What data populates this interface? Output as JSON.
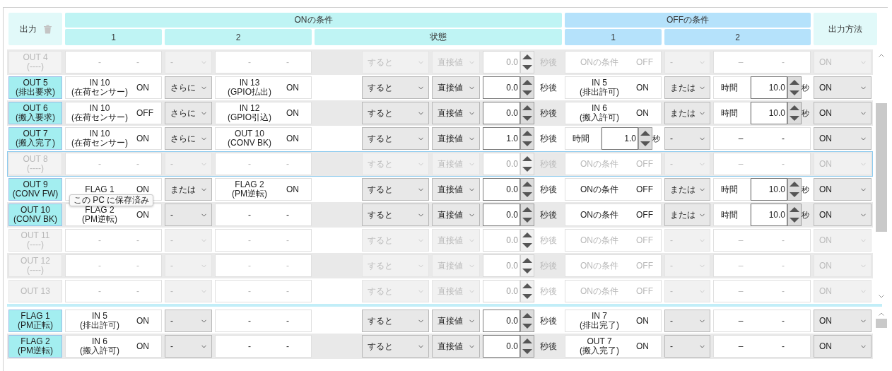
{
  "header": {
    "output": "出力",
    "on_group": "ONの条件",
    "on_cols": [
      "1",
      "2",
      "状態"
    ],
    "off_group": "OFFの条件",
    "off_cols": [
      "1",
      "2"
    ],
    "method": "出力方法"
  },
  "outputs": [
    {
      "label": "OUT 4",
      "sub": "(----)",
      "enabled": false,
      "selected": false,
      "on1": {
        "name": "-",
        "state": "-"
      },
      "on_join": "-",
      "on2": {
        "name": "-",
        "state": "-"
      },
      "trigger": "すると",
      "source": "直接値",
      "delay": "0.0",
      "delay_unit": "秒後",
      "off1": {
        "kind": "cond",
        "name": "ONの条件",
        "state": "OFF"
      },
      "off_join": "-",
      "off2": {
        "kind": "none",
        "mark": "–",
        "state": "-"
      },
      "method": "ON"
    },
    {
      "label": "OUT 5",
      "sub": "(排出要求)",
      "enabled": true,
      "selected": false,
      "on1": {
        "name": "IN 10",
        "sub": "(在荷センサー)",
        "state": "ON"
      },
      "on_join": "さらに",
      "on2": {
        "name": "IN 13",
        "sub": "(GPIO払出)",
        "state": "ON"
      },
      "trigger": "すると",
      "source": "直接値",
      "delay": "0.0",
      "delay_unit": "秒後",
      "off1": {
        "kind": "cond",
        "name": "IN 5",
        "sub": "(排出許可)",
        "state": "ON"
      },
      "off_join": "または",
      "off2": {
        "kind": "time",
        "label": "時間",
        "value": "10.0",
        "unit": "秒"
      },
      "method": "ON"
    },
    {
      "label": "OUT 6",
      "sub": "(搬入要求)",
      "enabled": true,
      "selected": false,
      "on1": {
        "name": "IN 10",
        "sub": "(在荷センサー)",
        "state": "OFF"
      },
      "on_join": "さらに",
      "on2": {
        "name": "IN 12",
        "sub": "(GPIO引込)",
        "state": "ON"
      },
      "trigger": "すると",
      "source": "直接値",
      "delay": "0.0",
      "delay_unit": "秒後",
      "off1": {
        "kind": "cond",
        "name": "IN 6",
        "sub": "(搬入許可)",
        "state": "ON"
      },
      "off_join": "または",
      "off2": {
        "kind": "time",
        "label": "時間",
        "value": "10.0",
        "unit": "秒"
      },
      "method": "ON"
    },
    {
      "label": "OUT 7",
      "sub": "(搬入完了)",
      "enabled": true,
      "selected": false,
      "on1": {
        "name": "IN 10",
        "sub": "(在荷センサー)",
        "state": "ON"
      },
      "on_join": "さらに",
      "on2": {
        "name": "OUT 10",
        "sub": "(CONV BK)",
        "state": "ON"
      },
      "trigger": "すると",
      "source": "直接値",
      "delay": "1.0",
      "delay_unit": "秒後",
      "off1": {
        "kind": "time",
        "label": "時間",
        "value": "1.0",
        "unit": "秒"
      },
      "off_join": "-",
      "off2": {
        "kind": "none",
        "mark": "–",
        "state": "-"
      },
      "method": "ON"
    },
    {
      "label": "OUT 8",
      "sub": "(----)",
      "enabled": false,
      "selected": true,
      "on1": {
        "name": "-",
        "state": "-"
      },
      "on_join": "-",
      "on2": {
        "name": "-",
        "state": "-"
      },
      "trigger": "すると",
      "source": "直接値",
      "delay": "0.0",
      "delay_unit": "秒後",
      "off1": {
        "kind": "cond",
        "name": "ONの条件",
        "state": "OFF"
      },
      "off_join": "-",
      "off2": {
        "kind": "none",
        "mark": "–",
        "state": "-"
      },
      "method": "ON"
    },
    {
      "label": "OUT 9",
      "sub": "(CONV FW)",
      "enabled": true,
      "selected": false,
      "on1": {
        "name": "FLAG 1",
        "state": "ON"
      },
      "on_join": "または",
      "on2": {
        "name": "FLAG 2",
        "sub": "(PM逆転)",
        "state": "ON"
      },
      "trigger": "すると",
      "source": "直接値",
      "delay": "0.0",
      "delay_unit": "秒後",
      "off1": {
        "kind": "cond",
        "name": "ONの条件",
        "state": "OFF"
      },
      "off_join": "または",
      "off2": {
        "kind": "time",
        "label": "時間",
        "value": "10.0",
        "unit": "秒"
      },
      "method": "ON"
    },
    {
      "label": "OUT 10",
      "sub": "(CONV BK)",
      "enabled": true,
      "selected": false,
      "on1": {
        "name": "FLAG 2",
        "sub": "(PM逆転)",
        "state": "ON"
      },
      "on_join": "-",
      "on2": {
        "name": "-",
        "state": "-"
      },
      "trigger": "すると",
      "source": "直接値",
      "delay": "0.0",
      "delay_unit": "秒後",
      "off1": {
        "kind": "cond",
        "name": "ONの条件",
        "state": "OFF"
      },
      "off_join": "または",
      "off2": {
        "kind": "time",
        "label": "時間",
        "value": "10.0",
        "unit": "秒"
      },
      "method": "ON"
    },
    {
      "label": "OUT 11",
      "sub": "(----)",
      "enabled": false,
      "selected": false,
      "on1": {
        "name": "-",
        "state": "-"
      },
      "on_join": "-",
      "on2": {
        "name": "-",
        "state": "-"
      },
      "trigger": "すると",
      "source": "直接値",
      "delay": "0.0",
      "delay_unit": "秒後",
      "off1": {
        "kind": "cond",
        "name": "ONの条件",
        "state": "OFF"
      },
      "off_join": "-",
      "off2": {
        "kind": "none",
        "mark": "–",
        "state": "-"
      },
      "method": "ON"
    },
    {
      "label": "OUT 12",
      "sub": "(----)",
      "enabled": false,
      "selected": false,
      "on1": {
        "name": "-",
        "state": "-"
      },
      "on_join": "-",
      "on2": {
        "name": "-",
        "state": "-"
      },
      "trigger": "すると",
      "source": "直接値",
      "delay": "0.0",
      "delay_unit": "秒後",
      "off1": {
        "kind": "cond",
        "name": "ONの条件",
        "state": "OFF"
      },
      "off_join": "-",
      "off2": {
        "kind": "none",
        "mark": "–",
        "state": "-"
      },
      "method": "ON"
    },
    {
      "label": "OUT 13",
      "enabled": false,
      "selected": false,
      "on1": {
        "name": "-",
        "state": "-"
      },
      "on_join": "-",
      "on2": {
        "name": "-",
        "state": "-"
      },
      "trigger": "すると",
      "source": "直接値",
      "delay": "0.0",
      "delay_unit": "秒後",
      "off1": {
        "kind": "cond",
        "name": "ONの条件",
        "state": "OFF"
      },
      "off_join": "-",
      "off2": {
        "kind": "none",
        "mark": "–",
        "state": "-"
      },
      "method": "ON"
    }
  ],
  "flags": [
    {
      "label": "FLAG 1",
      "sub": "(PM正転)",
      "enabled": true,
      "selected": false,
      "on1": {
        "name": "IN 5",
        "sub": "(排出許可)",
        "state": "ON"
      },
      "on_join": "-",
      "on2": {
        "name": "-",
        "state": "-"
      },
      "trigger": "すると",
      "source": "直接値",
      "delay": "0.0",
      "delay_unit": "秒後",
      "off1": {
        "kind": "cond",
        "name": "IN 7",
        "sub": "(排出完了)",
        "state": "ON"
      },
      "off_join": "-",
      "off2": {
        "kind": "none",
        "mark": "–",
        "state": "-"
      },
      "method": "ON"
    },
    {
      "label": "FLAG 2",
      "sub": "(PM逆転)",
      "enabled": true,
      "selected": false,
      "on1": {
        "name": "IN 6",
        "sub": "(搬入許可)",
        "state": "ON"
      },
      "on_join": "-",
      "on2": {
        "name": "-",
        "state": "-"
      },
      "trigger": "すると",
      "source": "直接値",
      "delay": "0.0",
      "delay_unit": "秒後",
      "off1": {
        "kind": "cond",
        "name": "OUT 7",
        "sub": "(搬入完了)",
        "state": "ON"
      },
      "off_join": "-",
      "off2": {
        "kind": "none",
        "mark": "–",
        "state": "-"
      },
      "method": "ON"
    }
  ],
  "tooltip": "この PC に保存済み"
}
